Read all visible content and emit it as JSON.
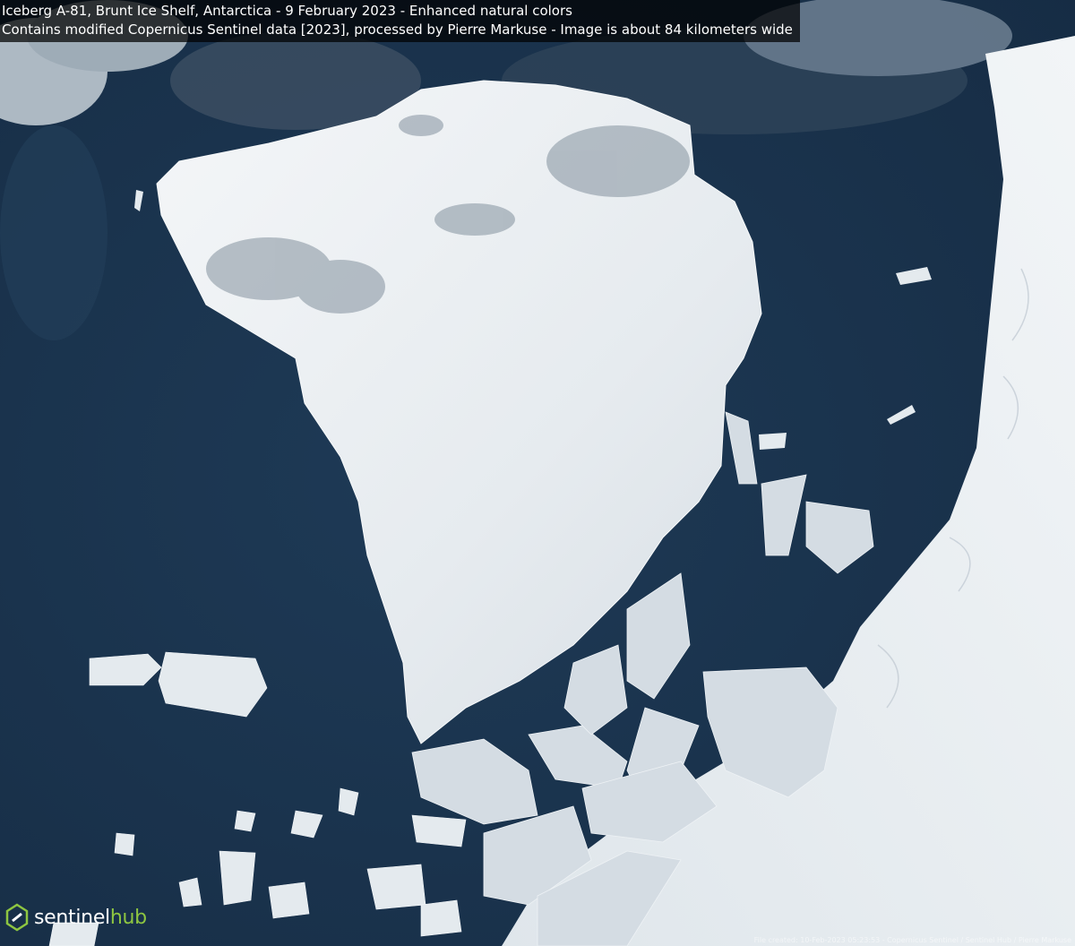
{
  "caption": {
    "line1": "Iceberg A-81, Brunt Ice Shelf, Antarctica - 9 February 2023 - Enhanced natural colors",
    "line2": "Contains modified Copernicus Sentinel data [2023], processed by Pierre Markuse - Image is about 84 kilometers wide"
  },
  "logo": {
    "part1": "sentinel",
    "part2": "hub",
    "accent_color": "#8ec641",
    "icon": "sentinel-hub-logo-icon"
  },
  "credit": "File created: 10-Feb-2023 05:23:53 - Copernicus Sentinel / Sentinel Hub / Pierre Markuse",
  "colors": {
    "ocean": "#1b3550",
    "ice": "#eef2f5",
    "shadow": "#a9b4bd"
  }
}
